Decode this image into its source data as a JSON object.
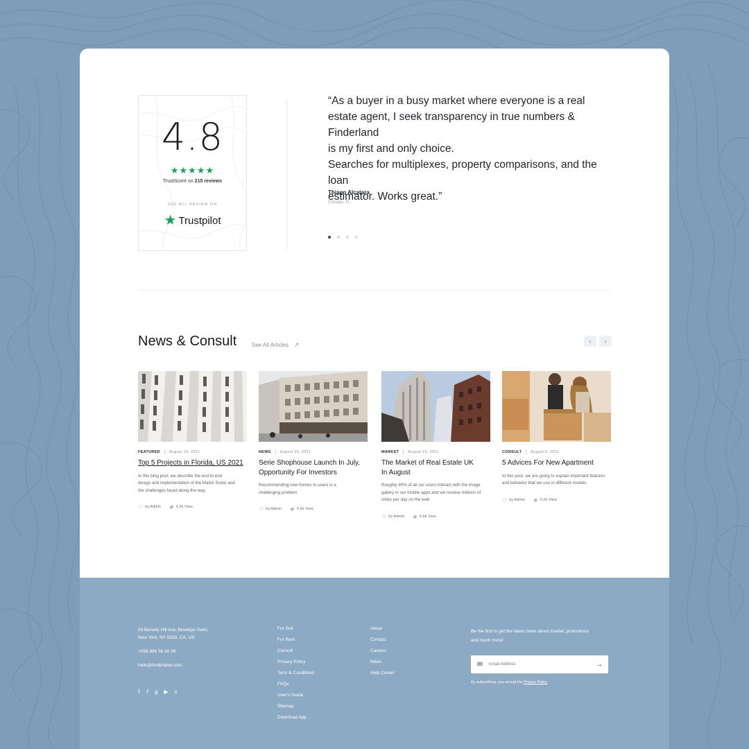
{
  "trustpilot": {
    "score": "4.8",
    "stars": "★★★★★",
    "trustscore_prefix": "TrustScore on",
    "reviews_count": "215 reviews",
    "see_all": "SEE ALL REVIEW ON",
    "brand": "Trustpilot"
  },
  "testimonial": {
    "quote": "“As a buyer in a busy market where everyone is a real\nestate agent, I seek transparency in true numbers & Finderland\nis my first and only choice.\nSearches for multiplexes, property comparisons, and the loan\nestimator. Works great.”",
    "author": "Thiago Alcatara",
    "location": "Chicago, FL",
    "dots": [
      true,
      false,
      false,
      false
    ]
  },
  "news": {
    "title": "News & Consult",
    "see_all": "See All Articles",
    "prev": "‹",
    "next": "›",
    "articles": [
      {
        "category": "FEATURED",
        "date": "August 24, 2021",
        "title": "Top 5 Projects in Florida, US 2021",
        "excerpt": "In this blog post, we describe the end to end\ndesign and implementation of the Match Score and\nthe challenges faced along the way.",
        "author": "by Admin",
        "views": "5,6k View"
      },
      {
        "category": "NEWS",
        "date": "August 20, 2021",
        "title": "Serie Shophouse Launch In July,\nOpportunity For Investors",
        "excerpt": "Recommending new homes to users is a\nchallenging problem",
        "author": "by Admin",
        "views": "5,6k View"
      },
      {
        "category": "MARKET",
        "date": "August 16, 2021",
        "title": "The Market of Real Estate UK\nIn August",
        "excerpt": "Roughly 85% of all our users interact with the image\ngallery in our mobile apps and we receive millions of\nclicks per day on the web",
        "author": "by Admin",
        "views": "5,6k View"
      },
      {
        "category": "CONSULT",
        "date": "August 5, 2021",
        "title": "5 Advices For New Apartment",
        "excerpt": "In this post, we are going to explain important features\nand behavior that we use in different models",
        "author": "by Admin",
        "views": "5,6k View"
      }
    ]
  },
  "footer": {
    "address_line1": "59 Bervely Hill Ave, Brooklyn Town,",
    "address_line2": "New York, NY 5630, CA, US",
    "phone": "+056 686 56 56 98",
    "email": "hello@finderland.com",
    "col1": [
      "For Sell",
      "For Rent",
      "Consult",
      "Privacy Policy",
      "Term & Conditions",
      "FAQs",
      "User's Guide",
      "Sitemap",
      "Download App"
    ],
    "col2": [
      "About",
      "Contact",
      "Careers",
      "News",
      "Help Center"
    ],
    "newsletter_text": "Be the first to get the latest news about market, promotions\nand much more!",
    "email_placeholder": "Email Address",
    "consent_prefix": "By subscribing, you accept the",
    "consent_link": "Privacy Policy",
    "social_icons": [
      "twitter-icon",
      "facebook-icon",
      "google-icon",
      "youtube-icon",
      "vimeo-icon"
    ]
  }
}
